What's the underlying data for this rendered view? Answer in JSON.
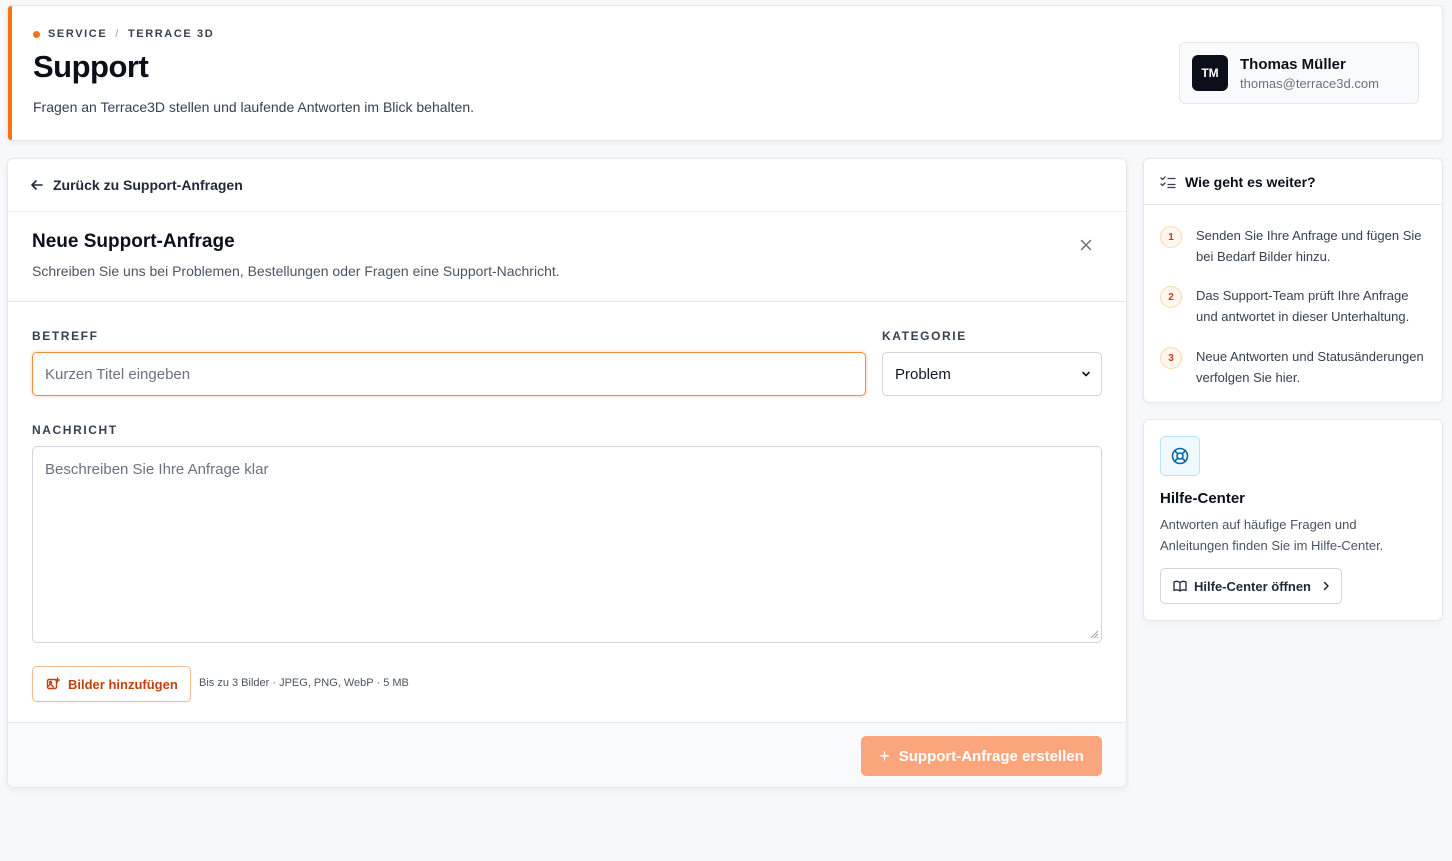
{
  "header": {
    "breadcrumb": [
      "SERVICE",
      "TERRACE 3D"
    ],
    "breadcrumb_separator": "/",
    "title": "Support",
    "subtitle": "Fragen an Terrace3D stellen und laufende Antworten im Blick behalten.",
    "user": {
      "initials": "TM",
      "name": "Thomas Müller",
      "email": "thomas@terrace3d.com"
    }
  },
  "main": {
    "back_label": "Zurück zu Support-Anfragen",
    "form_title": "Neue Support-Anfrage",
    "form_description": "Schreiben Sie uns bei Problemen, Bestellungen oder Fragen eine Support-Nachricht.",
    "subject_label": "BETREFF",
    "subject_placeholder": "Kurzen Titel eingeben",
    "subject_value": "",
    "category_label": "KATEGORIE",
    "category_value": "Problem",
    "message_label": "NACHRICHT",
    "message_placeholder": "Beschreiben Sie Ihre Anfrage klar",
    "add_images_label": "Bilder hinzufügen",
    "images_hint": "Bis zu 3 Bilder · JPEG, PNG, WebP · 5 MB",
    "submit_label": "Support-Anfrage erstellen"
  },
  "sidebar": {
    "next_steps_title": "Wie geht es weiter?",
    "steps": [
      {
        "num": "1",
        "text": "Senden Sie Ihre Anfrage und fügen Sie bei Bedarf Bilder hinzu."
      },
      {
        "num": "2",
        "text": "Das Support-Team prüft Ihre Anfrage und antwortet in dieser Unterhaltung."
      },
      {
        "num": "3",
        "text": "Neue Antworten und Statusänderungen verfolgen Sie hier."
      }
    ],
    "help": {
      "title": "Hilfe-Center",
      "description": "Antworten auf häufige Fragen und Anleitungen finden Sie im Hilfe-Center.",
      "button_label": "Hilfe-Center öffnen"
    }
  },
  "colors": {
    "accent": "#f97316",
    "submit_disabled": "#fba57c",
    "dark": "#0b0f19"
  },
  "icons": [
    "arrow-left-icon",
    "close-icon",
    "chevron-down-icon",
    "image-plus-icon",
    "plus-icon",
    "checklist-icon",
    "lifebuoy-icon",
    "book-icon",
    "chevron-right-icon"
  ]
}
